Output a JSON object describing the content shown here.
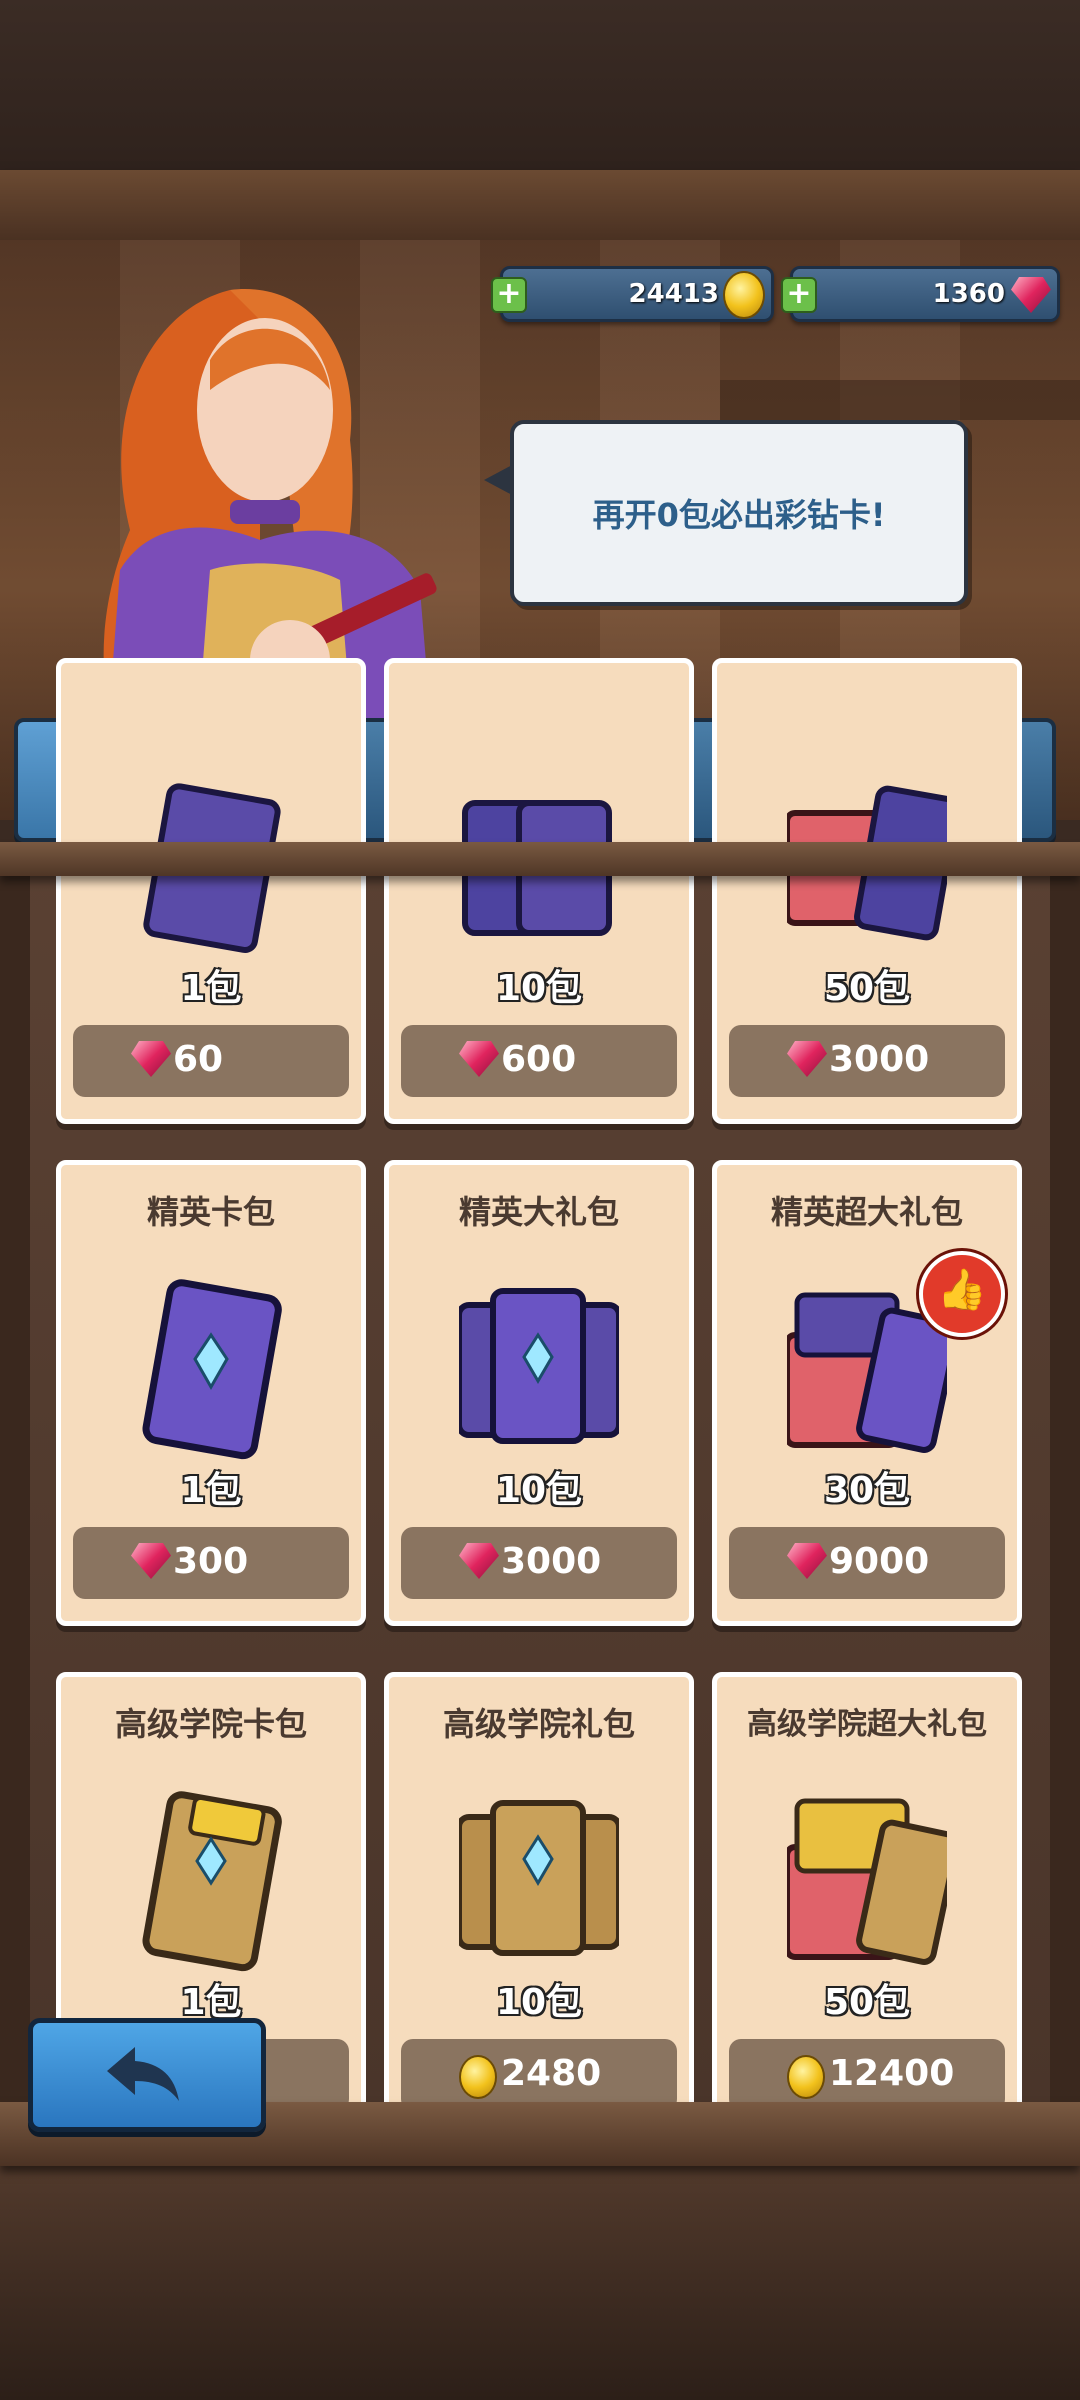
{
  "currency": {
    "gold": "24413",
    "gems": "1360",
    "gold_icon": "gold-coin-icon",
    "gem_icon": "ruby-gem-icon"
  },
  "npc": {
    "speech": "再开0包必出彩钻卡!"
  },
  "tabs": [
    {
      "name": "basic-pack-tab",
      "icon": "leather-pack-icon",
      "active": true
    },
    {
      "name": "pocket-watch-tab",
      "icon": "pocket-watch-icon",
      "active": false
    },
    {
      "name": "gem-tab",
      "icon": "ruby-gem-icon",
      "active": false
    },
    {
      "name": "book-tab",
      "icon": "spellbook-icon",
      "active": false
    },
    {
      "name": "thunder-book-tab",
      "icon": "thunder-book-icon",
      "active": false
    }
  ],
  "rows": [
    {
      "cards": [
        {
          "title": "",
          "qty": "1包",
          "price": "60",
          "currency": "gem"
        },
        {
          "title": "",
          "qty": "10包",
          "price": "600",
          "currency": "gem"
        },
        {
          "title": "",
          "qty": "50包",
          "price": "3000",
          "currency": "gem"
        }
      ]
    },
    {
      "cards": [
        {
          "title": "精英卡包",
          "qty": "1包",
          "price": "300",
          "currency": "gem"
        },
        {
          "title": "精英大礼包",
          "qty": "10包",
          "price": "3000",
          "currency": "gem"
        },
        {
          "title": "精英超大礼包",
          "qty": "30包",
          "price": "9000",
          "currency": "gem",
          "badge": "recommend"
        }
      ]
    },
    {
      "cards": [
        {
          "title": "高级学院卡包",
          "qty": "1包",
          "price": "",
          "currency": "gold"
        },
        {
          "title": "高级学院礼包",
          "qty": "10包",
          "price": "2480",
          "currency": "gold"
        },
        {
          "title": "高级学院超大礼包",
          "qty": "50包",
          "price": "12400",
          "currency": "gold"
        }
      ]
    }
  ],
  "colors": {
    "card_bg": "#f6dcbd",
    "price_bg": "#8a7460",
    "tab_blue": "#3a76a8",
    "speech_text": "#2d5f8a"
  }
}
